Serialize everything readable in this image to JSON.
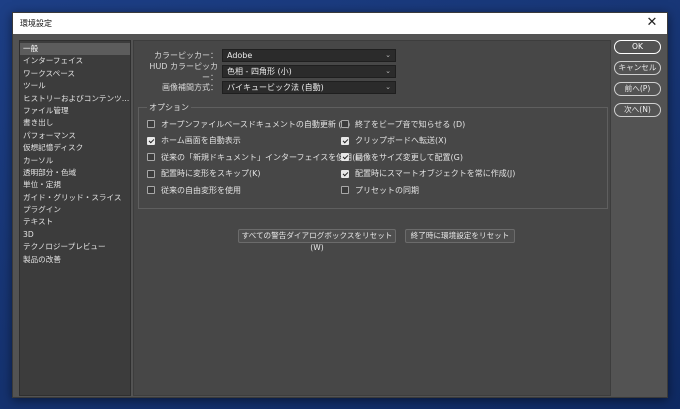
{
  "window": {
    "title": "環境設定",
    "close_glyph": "✕"
  },
  "sidebar": {
    "items": [
      {
        "label": "一般",
        "active": true
      },
      {
        "label": "インターフェイス"
      },
      {
        "label": "ワークスペース"
      },
      {
        "label": "ツール"
      },
      {
        "label": "ヒストリーおよびコンテンツ認証..."
      },
      {
        "label": "ファイル管理"
      },
      {
        "label": "書き出し"
      },
      {
        "label": "パフォーマンス"
      },
      {
        "label": "仮想記憶ディスク"
      },
      {
        "label": "カーソル"
      },
      {
        "label": "透明部分・色域"
      },
      {
        "label": "単位・定規"
      },
      {
        "label": "ガイド・グリッド・スライス"
      },
      {
        "label": "プラグイン"
      },
      {
        "label": "テキスト"
      },
      {
        "label": "3D"
      },
      {
        "label": "テクノロジープレビュー"
      },
      {
        "label": "製品の改善"
      }
    ]
  },
  "settings": {
    "color_picker": {
      "label": "カラーピッカー：",
      "value": "Adobe"
    },
    "hud_color_picker": {
      "label": "HUD カラーピッカー：",
      "value": "色相 - 四角形 (小)"
    },
    "interpolation": {
      "label": "画像補間方式：",
      "value": "バイキュービック法 (自動)"
    }
  },
  "options": {
    "title": "オプション",
    "left": [
      {
        "label": "オープンファイルベースドキュメントの自動更新 (A)",
        "checked": false
      },
      {
        "label": "ホーム画面を自動表示",
        "checked": true
      },
      {
        "label": "従来の「新規ドキュメント」インターフェイスを使用(L)",
        "checked": false
      },
      {
        "label": "配置時に変形をスキップ(K)",
        "checked": false
      },
      {
        "label": "従来の自由変形を使用",
        "checked": false
      }
    ],
    "right": [
      {
        "label": "終了をビープ音で知らせる (D)",
        "checked": false
      },
      {
        "label": "クリップボードへ転送(X)",
        "checked": true
      },
      {
        "label": "画像をサイズ変更して配置(G)",
        "checked": true
      },
      {
        "label": "配置時にスマートオブジェクトを常に作成(J)",
        "checked": true
      },
      {
        "label": "プリセットの同期",
        "checked": false
      }
    ]
  },
  "reset_buttons": {
    "warnings": "すべての警告ダイアログボックスをリセット (W)",
    "prefs_on_quit": "終了時に環境設定をリセット"
  },
  "actions": {
    "ok": "OK",
    "cancel": "キャンセル",
    "prev": "前へ(P)",
    "next": "次へ(N)"
  }
}
